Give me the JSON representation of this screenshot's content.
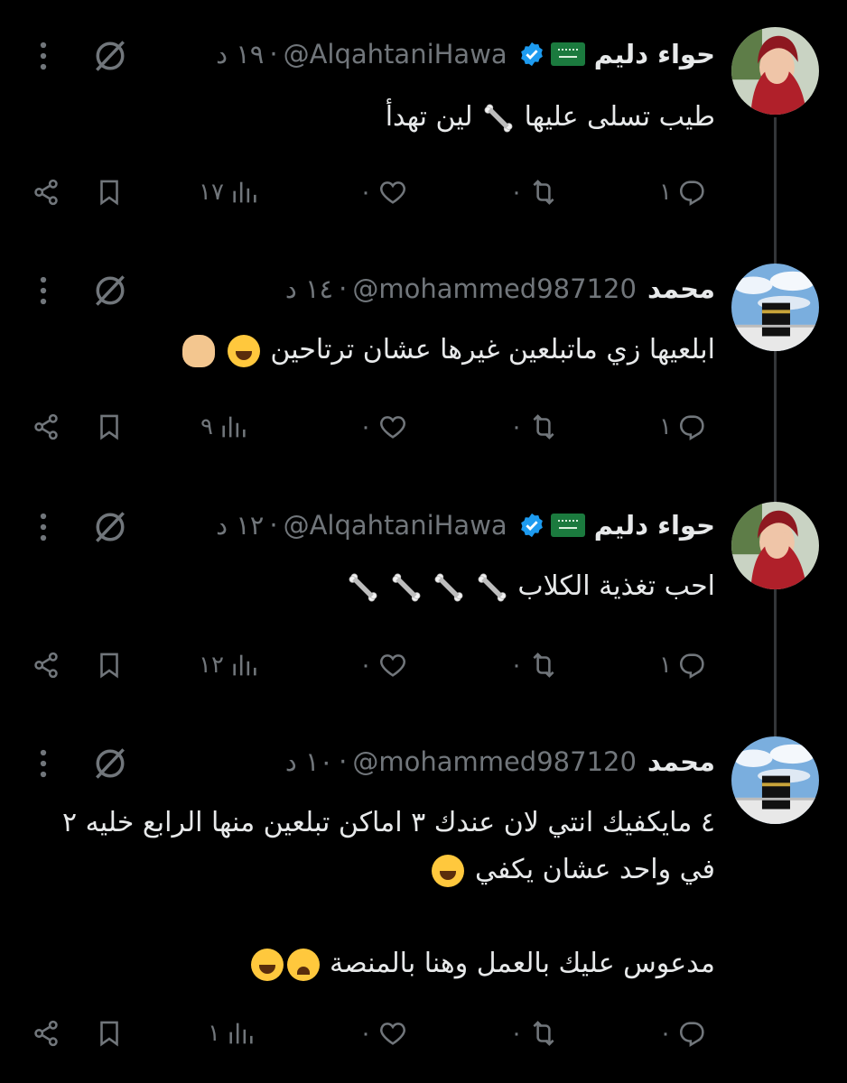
{
  "tweets": [
    {
      "name": "حواء دليم",
      "handle": "@AlqahtaniHawa",
      "time": "١٩ د",
      "verified": true,
      "flag": "saudi-flag",
      "text_lines": [
        "طيب تسلى عليها",
        "لين تهدأ"
      ],
      "replies": "١",
      "retweets": "٠",
      "likes": "٠",
      "views": "١٧"
    },
    {
      "name": "محمد",
      "handle": "@mohammed987120",
      "time": "١٤ د",
      "verified": false,
      "text": "ابلعيها زي ماتبلعين غيرها عشان ترتاحين",
      "replies": "١",
      "retweets": "٠",
      "likes": "٠",
      "views": "٩"
    },
    {
      "name": "حواء دليم",
      "handle": "@AlqahtaniHawa",
      "time": "١٢ د",
      "verified": true,
      "flag": "saudi-flag",
      "text": "احب تغذية الكلاب",
      "replies": "١",
      "retweets": "٠",
      "likes": "٠",
      "views": "١٢"
    },
    {
      "name": "محمد",
      "handle": "@mohammed987120",
      "time": "١٠ د",
      "verified": false,
      "text_line1": "٤ مايكفيك انتي لان عندك ٣ اماكن تبلعين منها الرابع خليه ٢",
      "text_line2": "في واحد عشان يكفي",
      "text_line3": "مدعوس عليك بالعمل وهنا بالمنصة",
      "replies": "٠",
      "retweets": "٠",
      "likes": "٠",
      "views": "١"
    }
  ],
  "separator": "·",
  "colors": {
    "background": "#000000",
    "text": "#e7e9ea",
    "muted": "#71767b",
    "verified": "#1d9bf0"
  }
}
